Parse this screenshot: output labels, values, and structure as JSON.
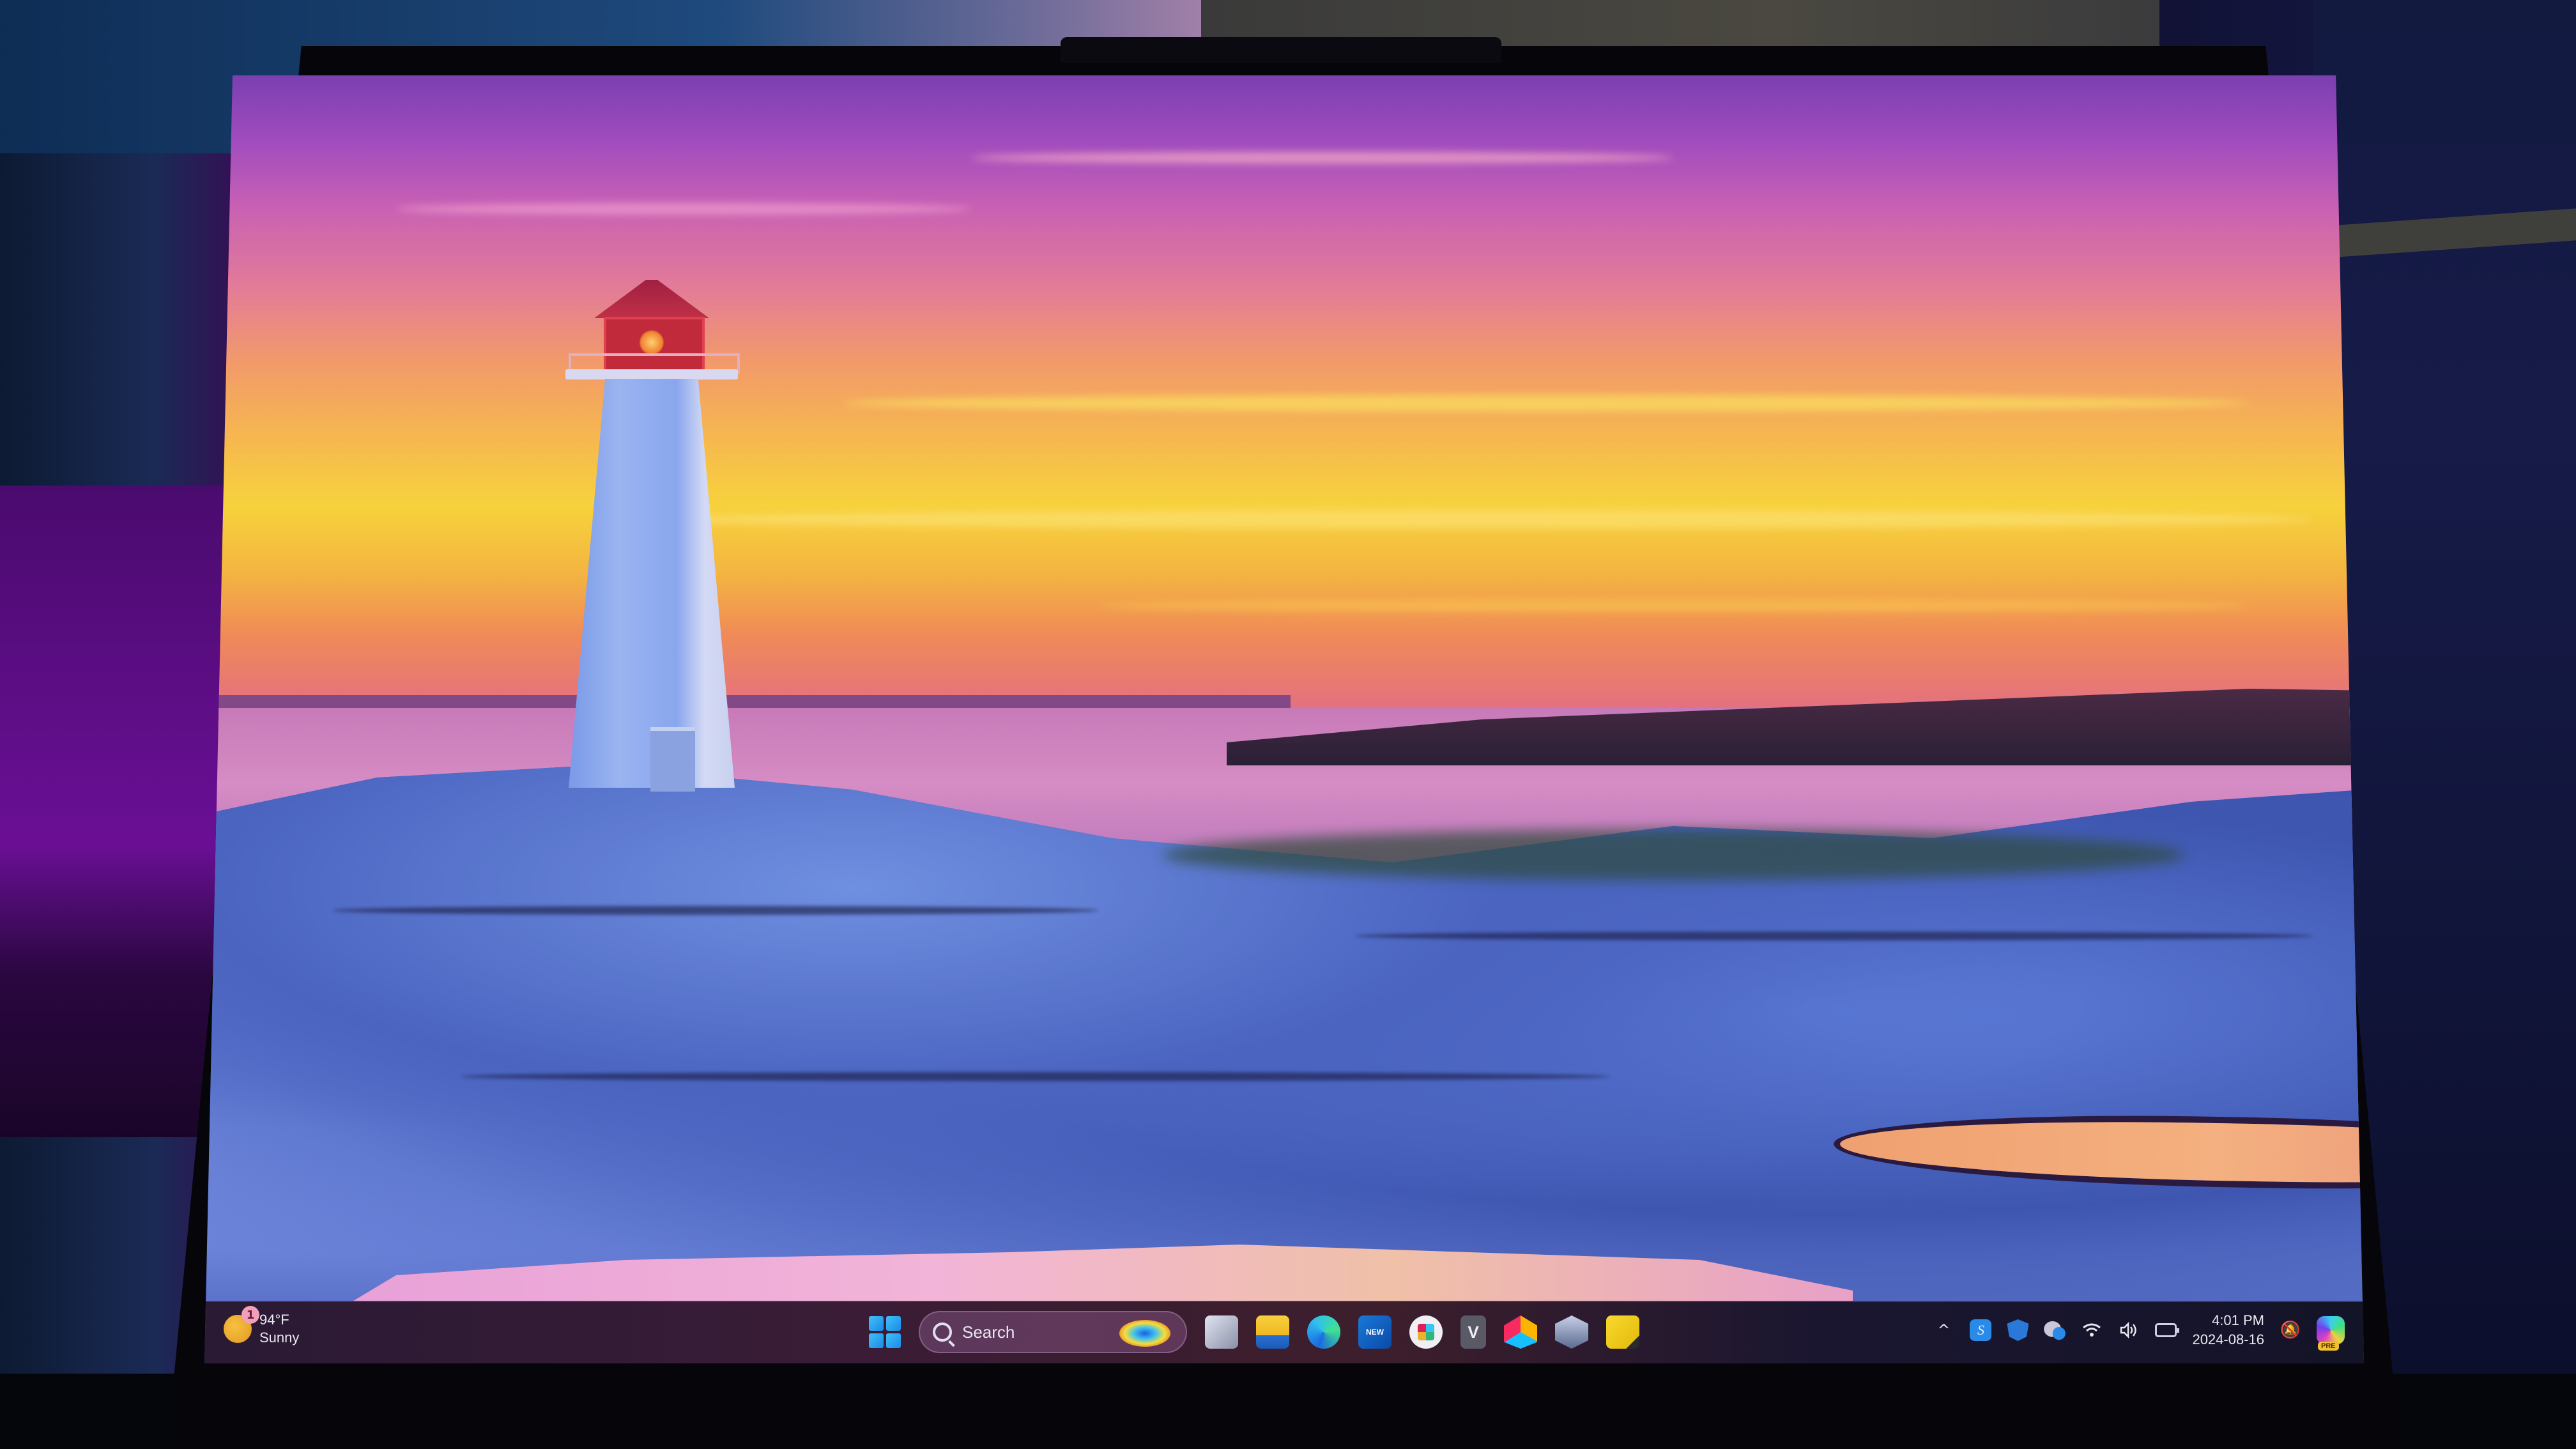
{
  "scene": {
    "description": "Laptop displaying a Windows 11 desktop",
    "wallpaper_subject": "Lighthouse on granite rocks at sunset"
  },
  "colors": {
    "sky_top": "#7a3fb0",
    "sky_mid": "#f6b84e",
    "sky_horizon": "#e06a8a",
    "water": "#d68cc4",
    "rocks": "#5a74d0",
    "lighthouse_red": "#c02a3a",
    "taskbar": "#2a1a34",
    "windows_accent": "#1a8ae8"
  },
  "taskbar": {
    "weather": {
      "icon": "sun-icon",
      "badge_count": "1",
      "temperature": "94°F",
      "condition": "Sunny"
    },
    "start_button": {
      "icon": "windows-logo-icon"
    },
    "search": {
      "icon": "search-icon",
      "placeholder": "Search",
      "highlight_icon": "search-highlight-image-icon"
    },
    "pinned_apps": [
      {
        "name": "Task View",
        "icon": "task-view-icon"
      },
      {
        "name": "File Explorer",
        "icon": "folder-icon"
      },
      {
        "name": "Microsoft Edge",
        "icon": "edge-icon"
      },
      {
        "name": "Outlook (new)",
        "icon": "outlook-icon",
        "label": "NEW"
      },
      {
        "name": "Slack",
        "icon": "slack-icon"
      },
      {
        "name": "V app",
        "icon": "v-app-icon",
        "label": "V"
      },
      {
        "name": "Airtable",
        "icon": "airtable-icon"
      },
      {
        "name": "Affinity",
        "icon": "hexagon-app-icon"
      },
      {
        "name": "Sticky Notes",
        "icon": "sticky-notes-icon"
      }
    ],
    "tray": {
      "overflow_icon": "chevron-up-icon",
      "chevron_glyph": "^",
      "icons": [
        {
          "name": "Surfshark",
          "icon": "surfshark-icon",
          "glyph": "S"
        },
        {
          "name": "Windows Security",
          "icon": "shield-check-icon"
        },
        {
          "name": "OneDrive",
          "icon": "cloud-info-icon"
        },
        {
          "name": "Wi-Fi",
          "icon": "wifi-icon"
        },
        {
          "name": "Volume",
          "icon": "speaker-icon"
        },
        {
          "name": "Battery",
          "icon": "battery-icon"
        }
      ],
      "time": "4:01 PM",
      "date": "2024-08-16",
      "notifications_icon": "bell-snooze-icon",
      "copilot": {
        "icon": "copilot-icon",
        "badge": "PRE"
      }
    }
  }
}
